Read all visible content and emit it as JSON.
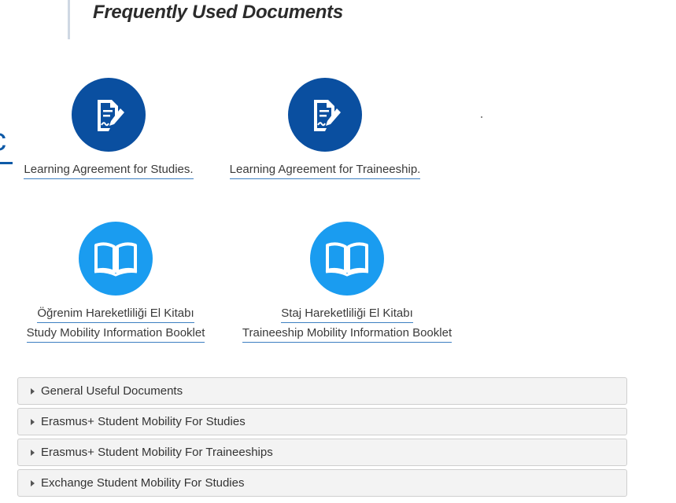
{
  "header": {
    "title": "Frequently Used Documents"
  },
  "left_fragment": {
    "text": "c"
  },
  "documents": [
    {
      "icon": "document-signature-icon",
      "style": "dark",
      "lines": [
        "Learning Agreement for Studies."
      ]
    },
    {
      "icon": "document-signature-icon",
      "style": "dark",
      "lines": [
        "Learning Agreement for Traineeship."
      ]
    },
    {
      "icon": "open-book-icon",
      "style": "light",
      "lines": [
        "Öğrenim Hareketliliği El Kitabı",
        "Study Mobility Information Booklet"
      ]
    },
    {
      "icon": "open-book-icon",
      "style": "light",
      "lines": [
        "Staj Hareketliliği El Kitabı",
        "Traineeship Mobility Information Booklet"
      ]
    }
  ],
  "accordion": [
    {
      "label": "General Useful Documents",
      "icon": "caret-right-icon"
    },
    {
      "label": "Erasmus+ Student Mobility For Studies",
      "icon": "caret-right-icon"
    },
    {
      "label": "Erasmus+ Student Mobility For Traineeships",
      "icon": "caret-right-icon"
    },
    {
      "label": "Exchange Student Mobility For Studies",
      "icon": "caret-right-icon"
    }
  ],
  "colors": {
    "dark_blue": "#0a4fa0",
    "light_blue": "#1a9cf0",
    "link_underline": "#3d7fc1",
    "accordion_bg": "#f3f3f3"
  }
}
